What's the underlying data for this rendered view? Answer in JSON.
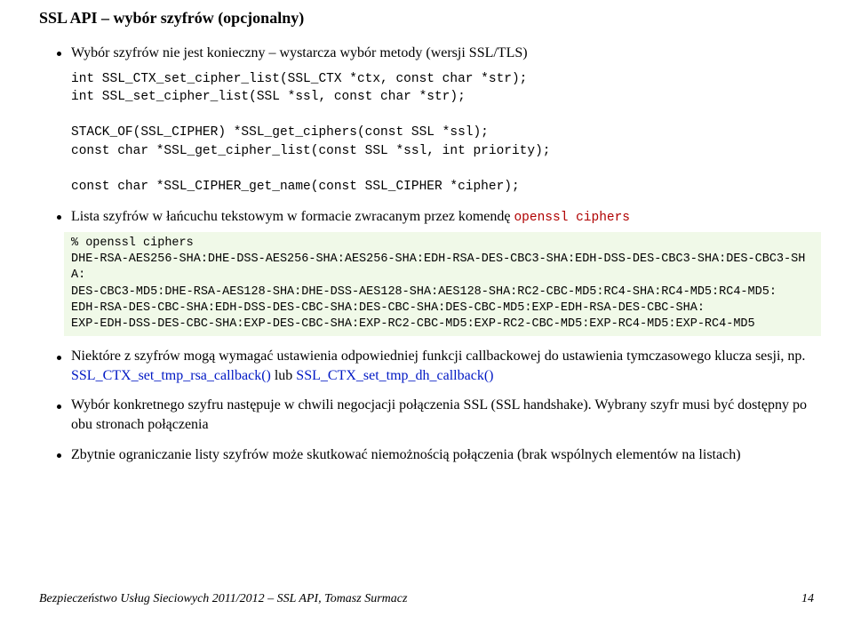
{
  "title": "SSL API – wybór szyfrów (opcjonalny)",
  "bullets": {
    "b1": {
      "text": "Wybór szyfrów nie jest konieczny – wystarcza wybór metody (wersji SSL/TLS)",
      "code": "int SSL_CTX_set_cipher_list(SSL_CTX *ctx, const char *str);\nint SSL_set_cipher_list(SSL *ssl, const char *str);\n\nSTACK_OF(SSL_CIPHER) *SSL_get_ciphers(const SSL *ssl);\nconst char *SSL_get_cipher_list(const SSL *ssl, int priority);\n\nconst char *SSL_CIPHER_get_name(const SSL_CIPHER *cipher);"
    },
    "b2": {
      "prefix": "Lista szyfrów w łańcuchu tekstowym w formacie zwracanym przez komendę ",
      "cmd": "openssl ciphers",
      "shaded": "% openssl ciphers\nDHE-RSA-AES256-SHA:DHE-DSS-AES256-SHA:AES256-SHA:EDH-RSA-DES-CBC3-SHA:EDH-DSS-DES-CBC3-SHA:DES-CBC3-SHA:\nDES-CBC3-MD5:DHE-RSA-AES128-SHA:DHE-DSS-AES128-SHA:AES128-SHA:RC2-CBC-MD5:RC4-SHA:RC4-MD5:RC4-MD5:\nEDH-RSA-DES-CBC-SHA:EDH-DSS-DES-CBC-SHA:DES-CBC-SHA:DES-CBC-MD5:EXP-EDH-RSA-DES-CBC-SHA:\nEXP-EDH-DSS-DES-CBC-SHA:EXP-DES-CBC-SHA:EXP-RC2-CBC-MD5:EXP-RC2-CBC-MD5:EXP-RC4-MD5:EXP-RC4-MD5"
    },
    "b3": {
      "prefix": "Niektóre z szyfrów mogą wymagać ustawienia odpowiedniej funkcji callbackowej do ustawienia tymczasowego klucza sesji, np. ",
      "link1": "SSL_CTX_set_tmp_rsa_callback()",
      "mid": " lub ",
      "link2": "SSL_CTX_set_tmp_dh_callback()"
    },
    "b4": "Wybór konkretnego szyfru następuje w chwili negocjacji połączenia SSL (SSL handshake). Wybrany szyfr musi być dostępny po obu stronach połączenia",
    "b5": "Zbytnie ograniczanie listy szyfrów może skutkować niemożnością połączenia (brak wspólnych elementów na listach)"
  },
  "footer": {
    "left": "Bezpieczeństwo Usług Sieciowych 2011/2012 – SSL API, Tomasz Surmacz",
    "right": "14"
  }
}
